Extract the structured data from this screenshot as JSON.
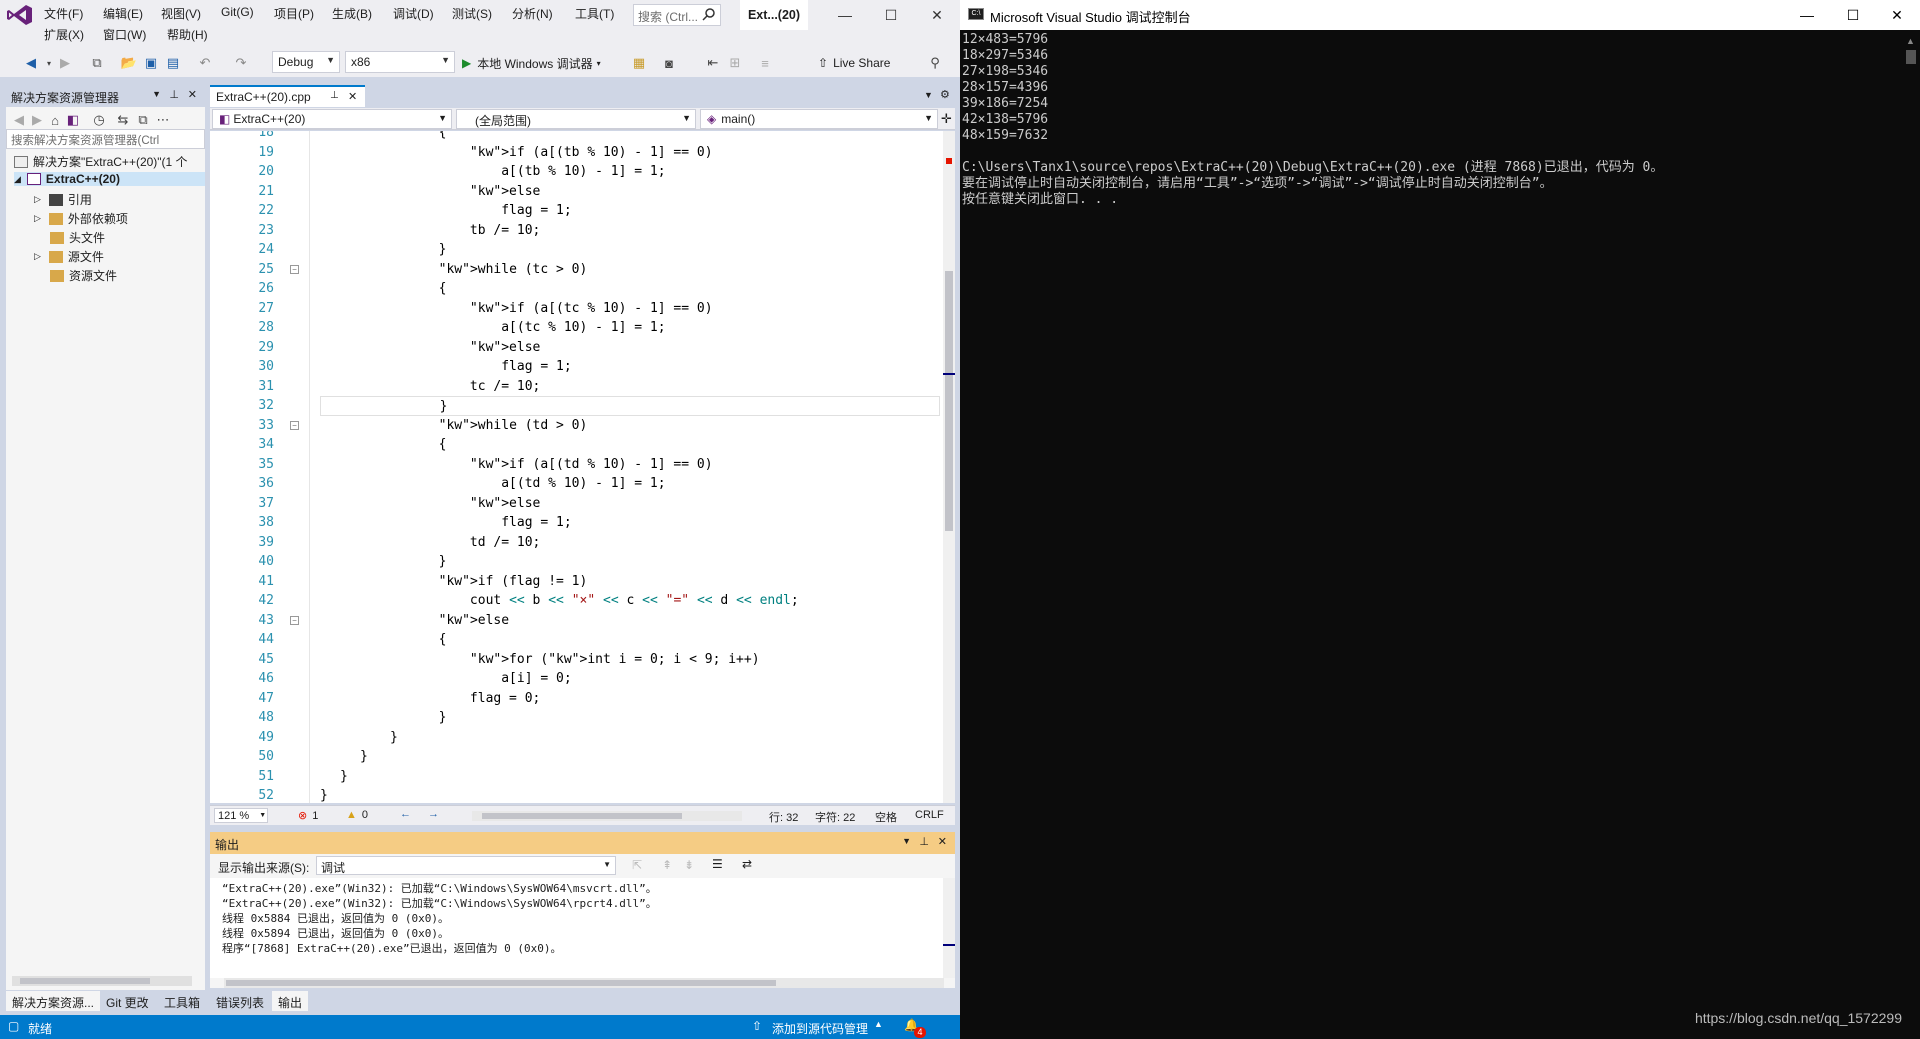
{
  "vs": {
    "menu": [
      "文件(F)",
      "编辑(E)",
      "视图(V)",
      "Git(G)",
      "项目(P)",
      "生成(B)",
      "调试(D)",
      "测试(S)",
      "分析(N)",
      "工具(T)"
    ],
    "menu2": [
      "扩展(X)",
      "窗口(W)",
      "帮助(H)"
    ],
    "search_placeholder": "搜索 (Ctrl...",
    "window_title": "Ext...(20)",
    "toolbar": {
      "config": "Debug",
      "platform": "x86",
      "run_label": "本地 Windows 调试器",
      "live_share": "Live Share"
    },
    "solution_explorer": {
      "title": "解决方案资源管理器",
      "search_placeholder": "搜索解决方案资源管理器(Ctrl",
      "items": [
        {
          "label": "解决方案\"ExtraC++(20)\"(1 个"
        },
        {
          "label": "ExtraC++(20)"
        },
        {
          "label": "引用"
        },
        {
          "label": "外部依赖项"
        },
        {
          "label": "头文件"
        },
        {
          "label": "源文件"
        },
        {
          "label": "资源文件"
        }
      ]
    },
    "editor": {
      "tab": "ExtraC++(20).cpp",
      "nav_project": "ExtraC++(20)",
      "nav_scope": "(全局范围)",
      "nav_func": "main()",
      "zoom": "121 %",
      "errors": "1",
      "warnings": "0",
      "line": "行: 32",
      "col": "字符: 22",
      "spaces": "空格",
      "eol": "CRLF"
    },
    "output": {
      "title": "输出",
      "source_label": "显示输出来源(S):",
      "source_value": "调试",
      "lines": [
        "“ExtraC++(20).exe”(Win32): 已加载“C:\\Windows\\SysWOW64\\msvcrt.dll”。",
        "“ExtraC++(20).exe”(Win32): 已加载“C:\\Windows\\SysWOW64\\rpcrt4.dll”。",
        "线程 0x5884 已退出，返回值为 0 (0x0)。",
        "线程 0x5894 已退出，返回值为 0 (0x0)。",
        "程序“[7868] ExtraC++(20).exe”已退出，返回值为 0 (0x0)。"
      ]
    },
    "bottom_tabs_left": [
      "解决方案资源...",
      "Git 更改",
      "工具箱"
    ],
    "bottom_tabs_right": [
      "错误列表",
      "输出"
    ],
    "status": {
      "ready": "就绪",
      "source_control": "添加到源代码管理",
      "notif": "4"
    }
  },
  "console": {
    "title": "Microsoft Visual Studio 调试控制台",
    "lines": [
      "12×483=5796",
      "18×297=5346",
      "27×198=5346",
      "28×157=4396",
      "39×186=7254",
      "42×138=5796",
      "48×159=7632",
      "",
      "C:\\Users\\Tanx1\\source\\repos\\ExtraC++(20)\\Debug\\ExtraC++(20).exe (进程 7868)已退出，代码为 0。",
      "要在调试停止时自动关闭控制台，请启用“工具”->“选项”->“调试”->“调试停止时自动关闭控制台”。",
      "按任意键关闭此窗口. . ."
    ],
    "watermark": "https://blog.csdn.net/qq_1572299"
  }
}
